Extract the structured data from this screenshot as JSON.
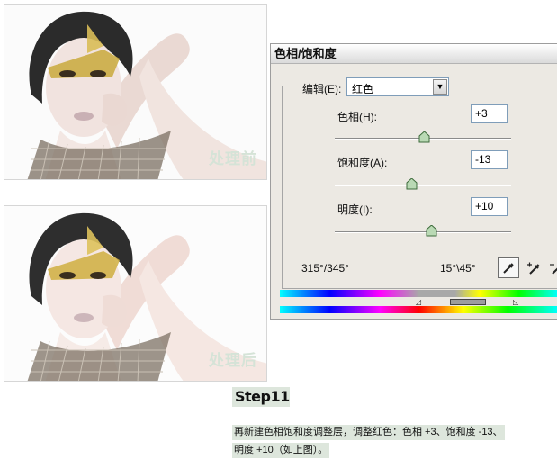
{
  "photos": {
    "before_caption": "处理前",
    "after_caption": "处理后"
  },
  "dialog": {
    "title": "色相/饱和度",
    "edit_label": "编辑(E):",
    "edit_value": "红色",
    "hue_label": "色相(H):",
    "hue_value": "+3",
    "hue_level": 3,
    "saturation_label": "饱和度(A):",
    "saturation_value": "-13",
    "saturation_level": -13,
    "lightness_label": "明度(I):",
    "lightness_value": "+10",
    "lightness_level": 10,
    "range_left": "315°/345°",
    "range_right": "15°\\45°",
    "tools": [
      "eyedropper-icon",
      "eyedropper-plus-icon",
      "eyedropper-minus-icon"
    ]
  },
  "step": {
    "title": "Step11",
    "line1": "再新建色相饱和度调整层，调整红色：色相 +3、饱和度 -13、",
    "line2": "明度 +10（如上图）。"
  }
}
